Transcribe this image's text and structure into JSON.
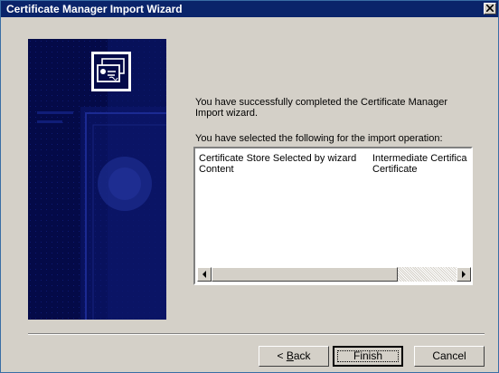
{
  "window": {
    "title": "Certificate Manager Import Wizard",
    "close_icon": "close-icon"
  },
  "wizard": {
    "completion_text": "You have successfully completed the Certificate Manager Import wizard.",
    "selection_label": "You have selected the following for the import operation:",
    "rows": [
      {
        "setting": "Certificate Store Selected by wizard",
        "value": "Intermediate Certifica"
      },
      {
        "setting": "Content",
        "value": "Certificate"
      }
    ],
    "banner_icon": "certificate-icon"
  },
  "buttons": {
    "back": "< Back",
    "back_mnemonic": "B",
    "finish": "Finish",
    "cancel": "Cancel"
  },
  "colors": {
    "title_bar": "#0a246a",
    "panel": "#040a48",
    "face": "#d4d0c8"
  }
}
